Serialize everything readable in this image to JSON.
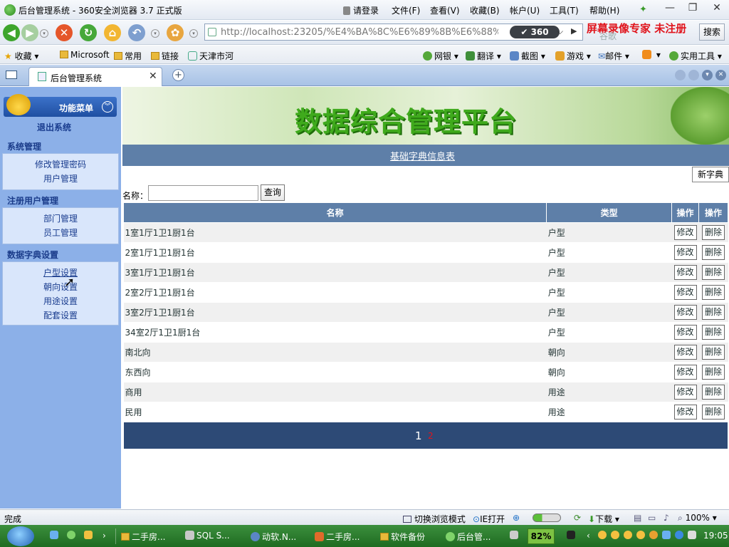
{
  "window": {
    "title": "后台管理系统 - 360安全浏览器 3.7 正式版",
    "login": "请登录",
    "menus": [
      "文件(F)",
      "查看(V)",
      "收藏(B)",
      "帐户(U)",
      "工具(T)",
      "帮助(H)"
    ]
  },
  "nav": {
    "url": "http://localhost:23205/%E4%BA%8C%E6%89%8B%E6%88%BF",
    "brand": "360",
    "search_hint": "谷歌",
    "search_label": "搜索",
    "watermark": "屏幕录像专家  未注册"
  },
  "favorites": {
    "items": [
      "收藏",
      "Microsoft",
      "常用",
      "链接",
      "天津市河"
    ],
    "tools": [
      "网银",
      "翻译",
      "截图",
      "游戏",
      "邮件",
      "实用工具"
    ]
  },
  "tab": {
    "label": "后台管理系统"
  },
  "sidebar": {
    "header": "功能菜单",
    "logout": "退出系统",
    "sections": [
      {
        "title": "系统管理",
        "items": [
          "修改管理密码",
          "用户管理"
        ]
      },
      {
        "title": "注册用户管理",
        "items": [
          "部门管理",
          "员工管理"
        ]
      },
      {
        "title": "数据字典设置",
        "items": [
          "户型设置",
          "朝向设置",
          "用途设置",
          "配套设置"
        ]
      }
    ]
  },
  "main": {
    "banner_title": "数据综合管理平台",
    "section_title": "基础字典信息表",
    "new_button": "新字典",
    "name_label": "名称：",
    "query_button": "查询",
    "columns": [
      "名称",
      "类型",
      "操作",
      "操作"
    ],
    "edit_label": "修改",
    "delete_label": "删除",
    "rows": [
      {
        "name": "1室1厅1卫1厨1台",
        "type": "户型"
      },
      {
        "name": "2室1厅1卫1厨1台",
        "type": "户型"
      },
      {
        "name": "3室1厅1卫1厨1台",
        "type": "户型"
      },
      {
        "name": "2室2厅1卫1厨1台",
        "type": "户型"
      },
      {
        "name": "3室2厅1卫1厨1台",
        "type": "户型"
      },
      {
        "name": "34室2厅1卫1厨1台",
        "type": "户型"
      },
      {
        "name": "南北向",
        "type": "朝向"
      },
      {
        "name": "东西向",
        "type": "朝向"
      },
      {
        "name": "商用",
        "type": "用途"
      },
      {
        "name": "民用",
        "type": "用途"
      }
    ],
    "pager": {
      "current": "1",
      "next": "2"
    }
  },
  "status": {
    "left": "完成",
    "switch_mode": "切换浏览模式",
    "ie_open": "IE打开",
    "download": "下载",
    "zoom": "100%"
  },
  "taskbar": {
    "tasks": [
      "二手房...",
      "SQL S...",
      "动软.N...",
      "二手房...",
      "软件备份",
      "后台管..."
    ],
    "battery": "82%",
    "clock": "19:05"
  }
}
